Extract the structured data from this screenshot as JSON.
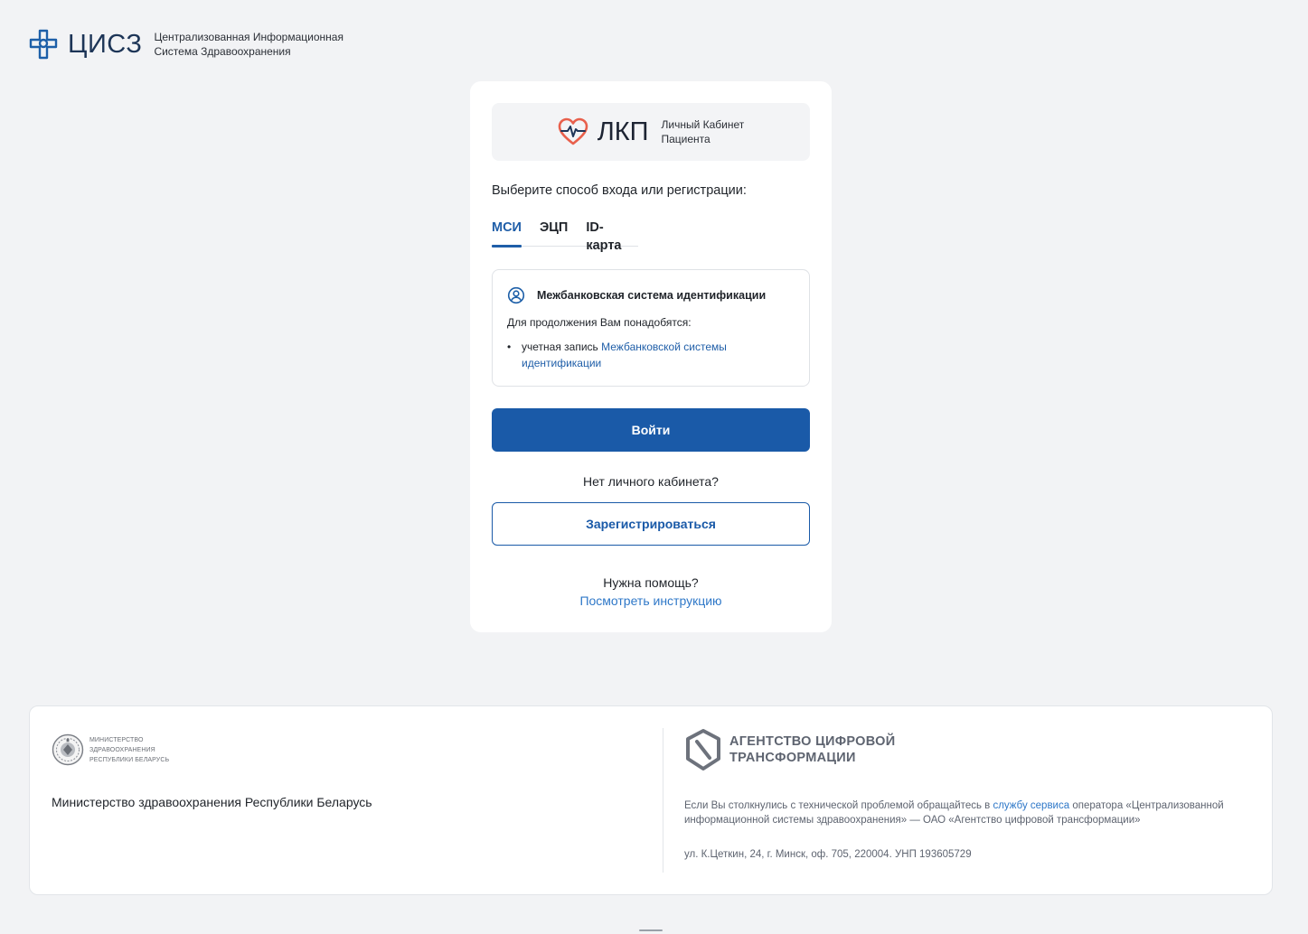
{
  "header": {
    "abbr": "ЦИСЗ",
    "subtitle_line1": "Централизованная Информационная",
    "subtitle_line2": "Система Здравоохранения",
    "icon": "medical-cross-logo-icon"
  },
  "card": {
    "banner": {
      "abbr": "ЛКП",
      "subtitle_line1": "Личный Кабинет",
      "subtitle_line2": "Пациента",
      "icon": "heart-pulse-logo-icon"
    },
    "choose_title": "Выберите способ входа или регистрации:",
    "tabs": [
      {
        "label": "МСИ",
        "active": true
      },
      {
        "label": "ЭЦП",
        "active": false
      },
      {
        "label": "ID-карта",
        "active": false
      }
    ],
    "info": {
      "icon": "user-circle-icon",
      "title": "Межбанковская система идентификации",
      "need_text": "Для продолжения Вам понадобятся:",
      "item_prefix": "учетная запись",
      "item_link": "Межбанковской системы идентификации"
    },
    "login_button": "Войти",
    "no_account_text": "Нет личного кабинета?",
    "register_button": "Зарегистрироваться",
    "help_question": "Нужна помощь?",
    "help_link": "Посмотреть инструкцию"
  },
  "footer": {
    "ministry_logo_line1": "Министерство",
    "ministry_logo_line2": "здравоохранения",
    "ministry_logo_line3": "Республики Беларусь",
    "ministry_name": "Министерство здравоохранения Республики Беларусь",
    "agency_name_line1": "АГЕНТСТВО ЦИФРОВОЙ",
    "agency_name_line2": "ТРАНСФОРМАЦИИ",
    "support_prefix": "Если Вы столкнулись с технической проблемой обращайтесь в",
    "support_link": "службу сервиса",
    "support_suffix": "оператора «Централизованной информационной системы здравоохранения» — ОАО «Агентство цифровой трансформации»",
    "address": "ул. К.Цеткин, 24, г. Минск, оф. 705, 220004. УНП 193605729"
  },
  "colors": {
    "primary": "#1a5aa8",
    "link": "#2f78c8",
    "background": "#f2f3f5",
    "heart": "#e8604c"
  }
}
